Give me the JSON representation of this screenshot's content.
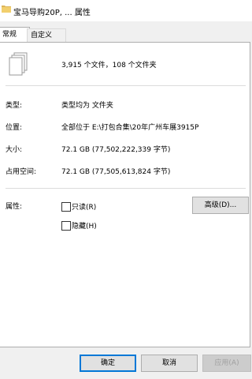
{
  "window": {
    "title": "宝马导购20P, ... 属性"
  },
  "tabs": [
    {
      "label": "常规"
    },
    {
      "label": "自定义"
    }
  ],
  "summary": {
    "text": "3,915 个文件，108 个文件夹"
  },
  "fields": {
    "type": {
      "label": "类型:",
      "value": "类型均为 文件夹"
    },
    "location": {
      "label": "位置:",
      "value": "全部位于 E:\\打包合集\\20年广州车展3915P"
    },
    "size": {
      "label": "大小:",
      "value": "72.1 GB (77,502,222,339 字节)"
    },
    "size_on_disk": {
      "label": "占用空间:",
      "value": "72.1 GB (77,505,613,824 字节)"
    }
  },
  "attributes": {
    "label": "属性:",
    "readonly": {
      "label": "只读(R)",
      "checked": false
    },
    "hidden": {
      "label": "隐藏(H)",
      "checked": false
    },
    "advanced_label": "高级(D)..."
  },
  "footer": {
    "ok_label": "确定",
    "cancel_label": "取消",
    "apply_label": "应用(A)"
  },
  "colors": {
    "accent": "#0078d7",
    "folder": "#dcb55a"
  }
}
